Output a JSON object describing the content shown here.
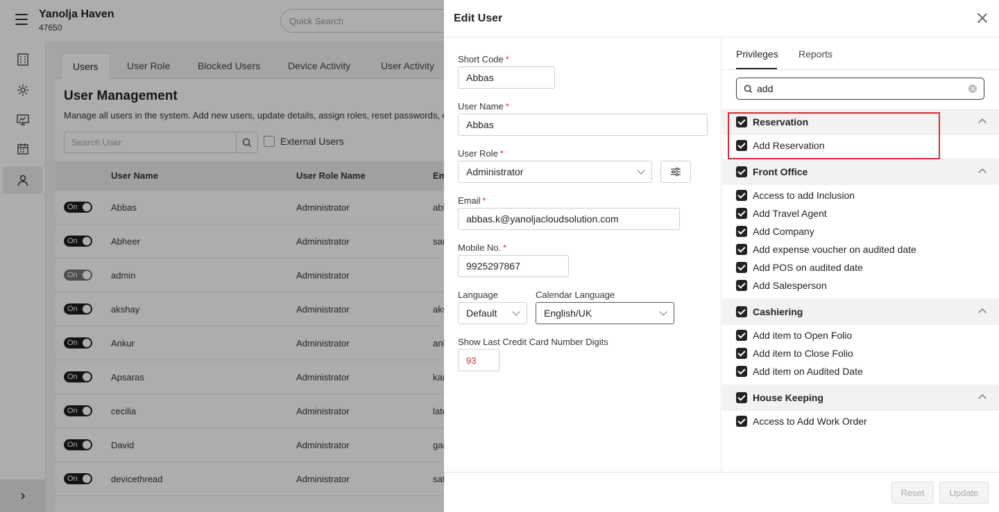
{
  "app": {
    "hotel_name": "Yanolja Haven",
    "hotel_code": "47650",
    "quick_search_placeholder": "Quick Search"
  },
  "nav": {
    "icons": [
      "building-icon",
      "settings-icon",
      "monitor-icon",
      "calendar-icon",
      "user-icon"
    ],
    "active": "user-icon"
  },
  "tabs": [
    "Users",
    "User Role",
    "Blocked Users",
    "Device Activity",
    "User Activity"
  ],
  "page": {
    "title": "User Management",
    "description": "Manage all users in the system. Add new users, update details, assign roles, reset passwords, or",
    "search_placeholder": "Search User",
    "external_users_label": "External Users"
  },
  "table": {
    "columns": [
      "User Name",
      "User Role Name",
      "Em"
    ],
    "rows": [
      {
        "toggle": "On",
        "name": "Abbas",
        "role": "Administrator",
        "email": "abl",
        "enabled": true
      },
      {
        "toggle": "On",
        "name": "Abheer",
        "role": "Administrator",
        "email": "sar",
        "enabled": true
      },
      {
        "toggle": "On",
        "name": "admin",
        "role": "Administrator",
        "email": "",
        "enabled": false
      },
      {
        "toggle": "On",
        "name": "akshay",
        "role": "Administrator",
        "email": "aks",
        "enabled": true
      },
      {
        "toggle": "On",
        "name": "Ankur",
        "role": "Administrator",
        "email": "ank",
        "enabled": true
      },
      {
        "toggle": "On",
        "name": "Apsaras",
        "role": "Administrator",
        "email": "kar",
        "enabled": true
      },
      {
        "toggle": "On",
        "name": "cecilia",
        "role": "Administrator",
        "email": "late",
        "enabled": true
      },
      {
        "toggle": "On",
        "name": "David",
        "role": "Administrator",
        "email": "gar",
        "enabled": true
      },
      {
        "toggle": "On",
        "name": "devicethread",
        "role": "Administrator",
        "email": "sat",
        "enabled": true
      }
    ]
  },
  "modal": {
    "title": "Edit User",
    "form": {
      "short_code": {
        "label": "Short Code",
        "value": "Abbas"
      },
      "user_name": {
        "label": "User Name",
        "value": "Abbas"
      },
      "user_role": {
        "label": "User Role",
        "value": "Administrator"
      },
      "email": {
        "label": "Email",
        "value": "abbas.k@yanoljacloudsolution.com"
      },
      "mobile": {
        "label": "Mobile No.",
        "value": "9925297867"
      },
      "language": {
        "label": "Language",
        "value": "Default"
      },
      "calendar_language": {
        "label": "Calendar Language",
        "value": "English/UK"
      },
      "cc_digits": {
        "label": "Show Last Credit Card Number Digits",
        "value": "93"
      },
      "required_mark": "*"
    },
    "privileges": {
      "tabs": [
        "Privileges",
        "Reports"
      ],
      "active_tab": "Privileges",
      "search_value": "add",
      "groups": [
        {
          "name": "Reservation",
          "checked": true,
          "items": [
            "Add Reservation"
          ]
        },
        {
          "name": "Front Office",
          "checked": true,
          "items": [
            "Access to add Inclusion",
            "Add Travel Agent",
            "Add Company",
            "Add expense voucher on audited date",
            "Add POS on audited date",
            "Add Salesperson"
          ]
        },
        {
          "name": "Cashiering",
          "checked": true,
          "items": [
            "Add item to Open Folio",
            "Add item to Close Folio",
            "Add item on Audited Date"
          ]
        },
        {
          "name": "House Keeping",
          "checked": true,
          "items": [
            "Access to Add Work Order"
          ]
        }
      ]
    },
    "footer": {
      "reset_label": "Reset",
      "update_label": "Update"
    }
  },
  "colors": {
    "accent": "#222222",
    "required": "#d32f2f",
    "highlight": "#d32f2f",
    "cc_value": "#d32f2f"
  }
}
